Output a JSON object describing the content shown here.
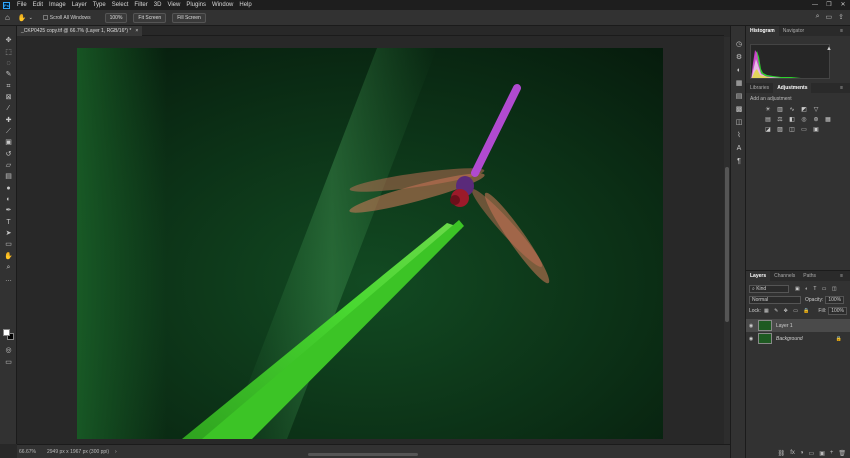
{
  "menu": {
    "items": [
      "File",
      "Edit",
      "Image",
      "Layer",
      "Type",
      "Select",
      "Filter",
      "3D",
      "View",
      "Plugins",
      "Window",
      "Help"
    ],
    "logo": "Ps"
  },
  "window_controls": [
    "—",
    "❐",
    "✕"
  ],
  "options": {
    "scroll_all": "Scroll All Windows",
    "zoom": "100%",
    "fit_screen": "Fit Screen",
    "fill_screen": "Fill Screen"
  },
  "document_tab": {
    "title": "_CKP0425 copy.tif @ 66.7% (Layer 1, RGB/16*) *",
    "close": "×"
  },
  "status": {
    "zoom": "66.67%",
    "info": "2949 px x 1967 px (300 ppi)",
    "arrow": "›"
  },
  "panels": {
    "top_tabs": [
      "Histogram",
      "Navigator"
    ],
    "mid_tabs": [
      "Libraries",
      "Adjustments"
    ],
    "adjust_hint": "Add an adjustment",
    "layer_tabs": [
      "Layers",
      "Channels",
      "Paths"
    ],
    "kind": "Kind",
    "blend_mode": "Normal",
    "opacity_label": "Opacity:",
    "opacity_value": "100%",
    "lock_label": "Lock:",
    "fill_label": "Fill:",
    "fill_value": "100%",
    "layers": [
      {
        "name": "Layer 1"
      },
      {
        "name": "Background"
      }
    ],
    "footer_icons": [
      "fx",
      "◑",
      "▭",
      "▣",
      "+",
      "🗑"
    ]
  },
  "colors": {
    "accent": "#31a8ff",
    "photo_dark": "#0d2a14",
    "leaf": "#3fcf2a",
    "dragonfly": "#b04ad0",
    "wing": "#d47a5a"
  }
}
